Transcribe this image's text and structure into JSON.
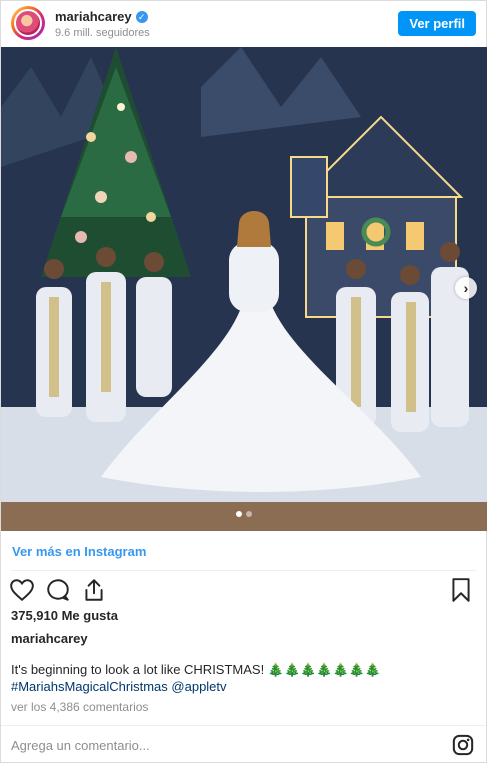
{
  "header": {
    "username": "mariahcarey",
    "verified_icon": "verified-badge-icon",
    "followers": "9.6 mill. seguidores",
    "view_profile_label": "Ver perfil"
  },
  "media": {
    "carousel_dots": 2,
    "active_dot": 1,
    "next_icon": "chevron-right-icon"
  },
  "links": {
    "view_more": "Ver más en Instagram"
  },
  "actions": {
    "icons": [
      "heart-icon",
      "comment-icon",
      "share-icon",
      "bookmark-icon"
    ]
  },
  "post": {
    "likes": "375,910 Me gusta",
    "caption_user": "mariahcarey",
    "caption_text": "It's beginning to look a lot like CHRISTMAS! 🎄🎄🎄🎄🎄🎄🎄",
    "hashtag": "#MariahsMagicalChristmas",
    "mention": "@appletv",
    "comments": "ver los 4,386 comentarios"
  },
  "footer": {
    "comment_placeholder": "Agrega un comentario...",
    "instagram_icon": "instagram-logo-icon"
  },
  "colors": {
    "accent": "#0095f6",
    "link": "#3897f0",
    "hashtag": "#00376b",
    "muted": "#8e8e8e"
  }
}
